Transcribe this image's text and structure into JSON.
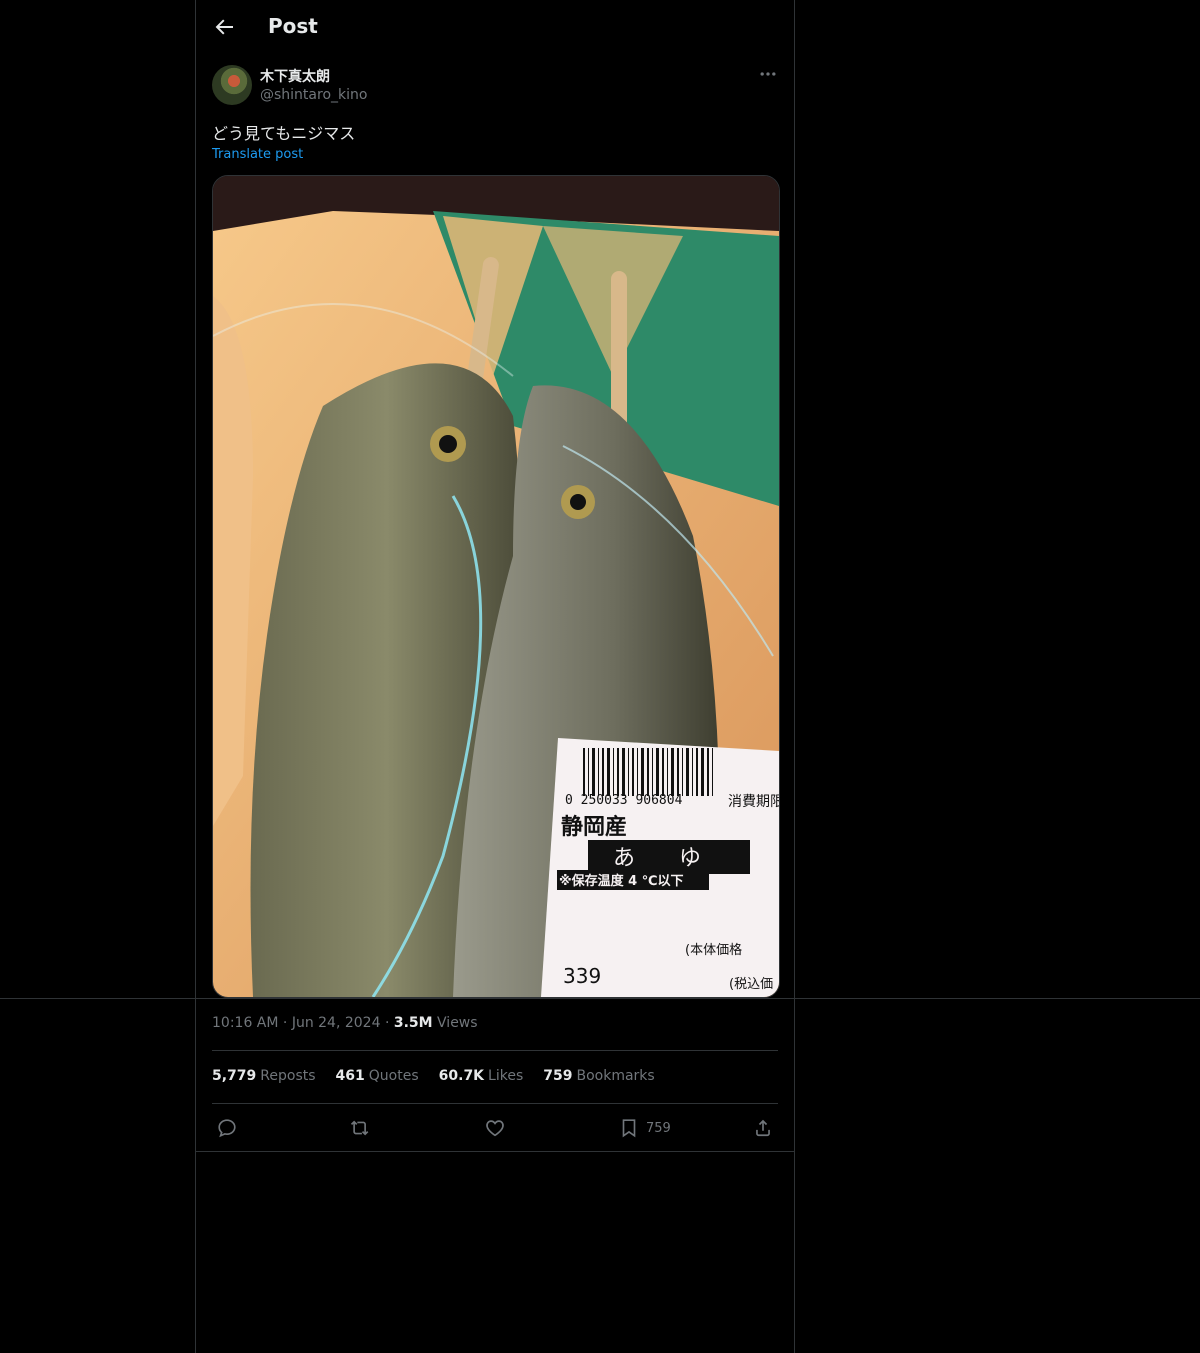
{
  "header": {
    "title": "Post"
  },
  "author": {
    "name": "木下真太朗",
    "handle": "@shintaro_kino"
  },
  "post": {
    "text": "どう見てもニジマス",
    "translate_label": "Translate post"
  },
  "media": {
    "label": {
      "barcode_number": "0 250033 906804",
      "expiry": "消費期限",
      "origin": "静岡産",
      "product": "あ　　ゆ",
      "storage": "※保存温度 4 ℃以下",
      "price_label": "(本体価格",
      "tax_label": "(税込価",
      "price": "339"
    }
  },
  "meta": {
    "time": "10:16 AM",
    "date": "Jun 24, 2024",
    "views_count": "3.5M",
    "views_label": "Views"
  },
  "stats": [
    {
      "count": "5,779",
      "label": "Reposts"
    },
    {
      "count": "461",
      "label": "Quotes"
    },
    {
      "count": "60.7K",
      "label": "Likes"
    },
    {
      "count": "759",
      "label": "Bookmarks"
    }
  ],
  "actions": {
    "bookmark_count": "759"
  },
  "icons": [
    "back-arrow-icon",
    "more-icon",
    "reply-icon",
    "repost-icon",
    "like-icon",
    "bookmark-icon",
    "share-icon"
  ],
  "colors": {
    "background": "#000000",
    "text": "#e7e9ea",
    "muted": "#71767b",
    "link": "#1d9bf0",
    "border": "#2f3336"
  }
}
